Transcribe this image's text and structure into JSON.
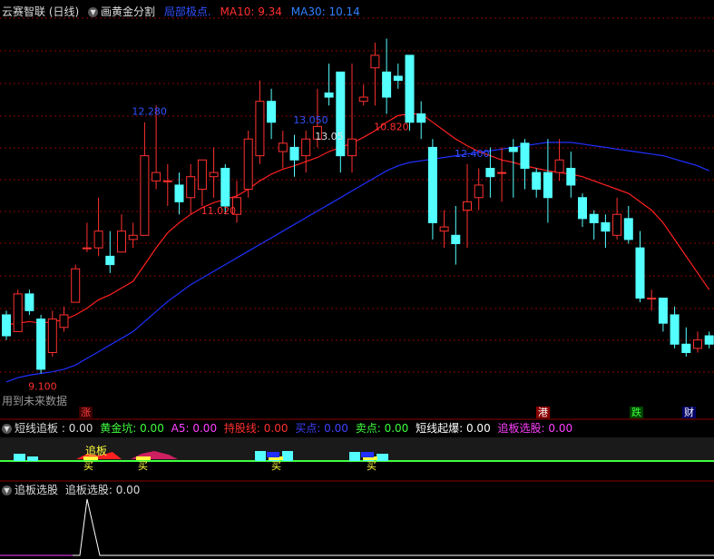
{
  "main_header": {
    "title": "云赛智联 (日线)",
    "indicator": "画黄金分割",
    "items": [
      {
        "text": "局部极点.",
        "color": "#3050ff"
      },
      {
        "text": "MA10: 9.34",
        "color": "#ff3030"
      },
      {
        "text": "MA30: 10.14",
        "color": "#3080ff"
      }
    ]
  },
  "future_data_label": "用到未来数据",
  "event_tags": [
    {
      "text": "涨",
      "bg": "#8b0000",
      "color": "#ff4040"
    },
    {
      "text": "港",
      "bg": "#8b0000",
      "color": "#ffffff"
    },
    {
      "text": "跌",
      "bg": "#005500",
      "color": "#40ff40"
    },
    {
      "text": "财",
      "bg": "#000080",
      "color": "#ffffff"
    }
  ],
  "sub1_header": {
    "title": "短线追板",
    "items": [
      {
        "text": ": 0.00",
        "color": "#dddddd"
      },
      {
        "text": "黄金坑: 0.00",
        "color": "#40ff40"
      },
      {
        "text": "A5: 0.00",
        "color": "#ff40ff"
      },
      {
        "text": "持股线: 0.00",
        "color": "#ff3030"
      },
      {
        "text": "买点: 0.00",
        "color": "#4040ff"
      },
      {
        "text": "卖点: 0.00",
        "color": "#40ff40"
      },
      {
        "text": "短线起爆: 0.00",
        "color": "#ffffff"
      },
      {
        "text": "追板选股: 0.00",
        "color": "#ff40ff"
      }
    ]
  },
  "sub1_labels": {
    "chase": "追板",
    "buy": "买"
  },
  "sub2_header": {
    "title": "追板选股",
    "items": [
      {
        "text": "追板选股: 0.00",
        "color": "#dddddd"
      }
    ]
  },
  "colors": {
    "up": "#ff3030",
    "down": "#54ffff",
    "ma10": "#ff2020",
    "ma30": "#2030ff",
    "grid": "#8b0000",
    "peak_label": "#3050ff",
    "trough_label": "#ff3030"
  },
  "chart_data": {
    "type": "candlestick",
    "price_range": [
      8.9,
      13.3
    ],
    "extreme_labels": [
      {
        "text": "9.100",
        "kind": "trough",
        "bar": 3
      },
      {
        "text": "12.280",
        "kind": "peak",
        "bar": 12
      },
      {
        "text": "11.020",
        "kind": "trough",
        "bar": 18
      },
      {
        "text": "13.050",
        "kind": "peak",
        "bar": 26
      },
      {
        "text": "13.05",
        "kind": "current",
        "bar": 26
      },
      {
        "text": "10.820",
        "kind": "trough",
        "bar": 33
      },
      {
        "text": "12.400",
        "kind": "peak",
        "bar": 40
      }
    ],
    "candles": [
      [
        9.8,
        9.55,
        9.85,
        9.5
      ],
      [
        9.6,
        10.05,
        10.1,
        9.6
      ],
      [
        10.05,
        9.85,
        10.1,
        9.8
      ],
      [
        9.75,
        9.15,
        9.8,
        9.1
      ],
      [
        9.35,
        9.75,
        9.85,
        9.3
      ],
      [
        9.65,
        9.8,
        9.9,
        9.6
      ],
      [
        9.95,
        10.35,
        10.4,
        9.95
      ],
      [
        10.6,
        10.6,
        10.9,
        10.55
      ],
      [
        10.6,
        10.8,
        11.2,
        10.5
      ],
      [
        10.5,
        10.4,
        10.8,
        10.3
      ],
      [
        10.55,
        10.8,
        11.0,
        10.55
      ],
      [
        10.7,
        10.75,
        10.9,
        10.6
      ],
      [
        10.75,
        11.7,
        12.1,
        10.75
      ],
      [
        11.4,
        11.5,
        12.3,
        11.3
      ],
      [
        11.4,
        11.4,
        11.6,
        11.1
      ],
      [
        11.35,
        11.15,
        11.5,
        11.0
      ],
      [
        11.2,
        11.45,
        11.6,
        11.0
      ],
      [
        11.3,
        11.65,
        11.6,
        11.1
      ],
      [
        11.45,
        11.5,
        11.8,
        11.2
      ],
      [
        11.55,
        11.1,
        11.6,
        11.0
      ],
      [
        11.0,
        11.2,
        11.4,
        10.9
      ],
      [
        11.3,
        11.9,
        12.0,
        11.2
      ],
      [
        11.7,
        12.35,
        12.6,
        11.6
      ],
      [
        12.35,
        12.1,
        12.5,
        11.9
      ],
      [
        11.75,
        11.85,
        12.0,
        11.55
      ],
      [
        11.8,
        11.65,
        11.95,
        11.45
      ],
      [
        11.7,
        11.9,
        12.0,
        11.5
      ],
      [
        11.9,
        12.05,
        12.5,
        11.8
      ],
      [
        12.45,
        12.4,
        12.8,
        12.3
      ],
      [
        12.7,
        11.7,
        12.7,
        11.5
      ],
      [
        11.7,
        11.9,
        12.8,
        11.5
      ],
      [
        12.35,
        12.4,
        12.55,
        12.3
      ],
      [
        12.75,
        12.9,
        13.05,
        12.3
      ],
      [
        12.7,
        12.4,
        13.1,
        12.2
      ],
      [
        12.65,
        12.6,
        12.8,
        12.5
      ],
      [
        12.9,
        12.1,
        12.9,
        12.0
      ],
      [
        12.2,
        12.1,
        12.35,
        11.9
      ],
      [
        11.8,
        10.9,
        11.9,
        10.7
      ],
      [
        10.8,
        10.85,
        11.05,
        10.6
      ],
      [
        10.75,
        10.65,
        11.1,
        10.4
      ],
      [
        11.05,
        11.15,
        11.6,
        10.6
      ],
      [
        11.2,
        11.35,
        11.55,
        11.05
      ],
      [
        11.55,
        11.45,
        11.8,
        11.2
      ],
      [
        11.5,
        11.5,
        11.8,
        11.15
      ],
      [
        11.8,
        11.75,
        11.9,
        11.2
      ],
      [
        11.85,
        11.55,
        11.9,
        11.3
      ],
      [
        11.5,
        11.3,
        11.55,
        11.2
      ],
      [
        11.5,
        11.2,
        11.9,
        10.9
      ],
      [
        11.5,
        11.65,
        11.9,
        11.4
      ],
      [
        11.55,
        11.35,
        11.75,
        11.2
      ],
      [
        11.2,
        10.95,
        11.25,
        10.85
      ],
      [
        11.0,
        10.9,
        11.05,
        10.7
      ],
      [
        10.9,
        10.8,
        11.0,
        10.6
      ],
      [
        10.75,
        11.0,
        11.2,
        10.7
      ],
      [
        10.95,
        10.7,
        11.1,
        10.65
      ],
      [
        10.6,
        10.0,
        10.8,
        9.95
      ],
      [
        10.0,
        10.0,
        10.1,
        9.85
      ],
      [
        10.0,
        9.7,
        10.0,
        9.6
      ],
      [
        9.8,
        9.45,
        9.9,
        9.4
      ],
      [
        9.45,
        9.35,
        9.65,
        9.3
      ],
      [
        9.4,
        9.5,
        9.6,
        9.35
      ],
      [
        9.55,
        9.45,
        9.6,
        9.4
      ]
    ],
    "ma10": [
      9.68,
      9.7,
      9.72,
      9.7,
      9.72,
      9.74,
      9.8,
      9.88,
      9.98,
      10.04,
      10.12,
      10.2,
      10.4,
      10.6,
      10.78,
      10.9,
      11.0,
      11.08,
      11.14,
      11.18,
      11.22,
      11.3,
      11.4,
      11.48,
      11.54,
      11.58,
      11.63,
      11.68,
      11.75,
      11.8,
      11.85,
      11.92,
      12.0,
      12.1,
      12.18,
      12.2,
      12.2,
      12.1,
      12.0,
      11.9,
      11.82,
      11.75,
      11.7,
      11.65,
      11.62,
      11.58,
      11.55,
      11.52,
      11.5,
      11.48,
      11.45,
      11.4,
      11.35,
      11.3,
      11.25,
      11.15,
      11.05,
      10.9,
      10.7,
      10.5,
      10.3,
      10.1
    ],
    "ma30": [
      9.0,
      9.05,
      9.08,
      9.1,
      9.12,
      9.15,
      9.2,
      9.28,
      9.36,
      9.44,
      9.52,
      9.6,
      9.72,
      9.84,
      9.96,
      10.06,
      10.16,
      10.24,
      10.32,
      10.4,
      10.48,
      10.56,
      10.64,
      10.72,
      10.8,
      10.88,
      10.96,
      11.04,
      11.12,
      11.2,
      11.28,
      11.36,
      11.44,
      11.52,
      11.58,
      11.62,
      11.64,
      11.66,
      11.68,
      11.7,
      11.72,
      11.74,
      11.76,
      11.78,
      11.8,
      11.82,
      11.84,
      11.86,
      11.86,
      11.86,
      11.84,
      11.82,
      11.8,
      11.78,
      11.76,
      11.74,
      11.72,
      11.7,
      11.66,
      11.62,
      11.58,
      11.52
    ],
    "sub2_values": [
      0,
      0,
      0,
      0,
      0,
      0,
      1,
      0
    ]
  }
}
